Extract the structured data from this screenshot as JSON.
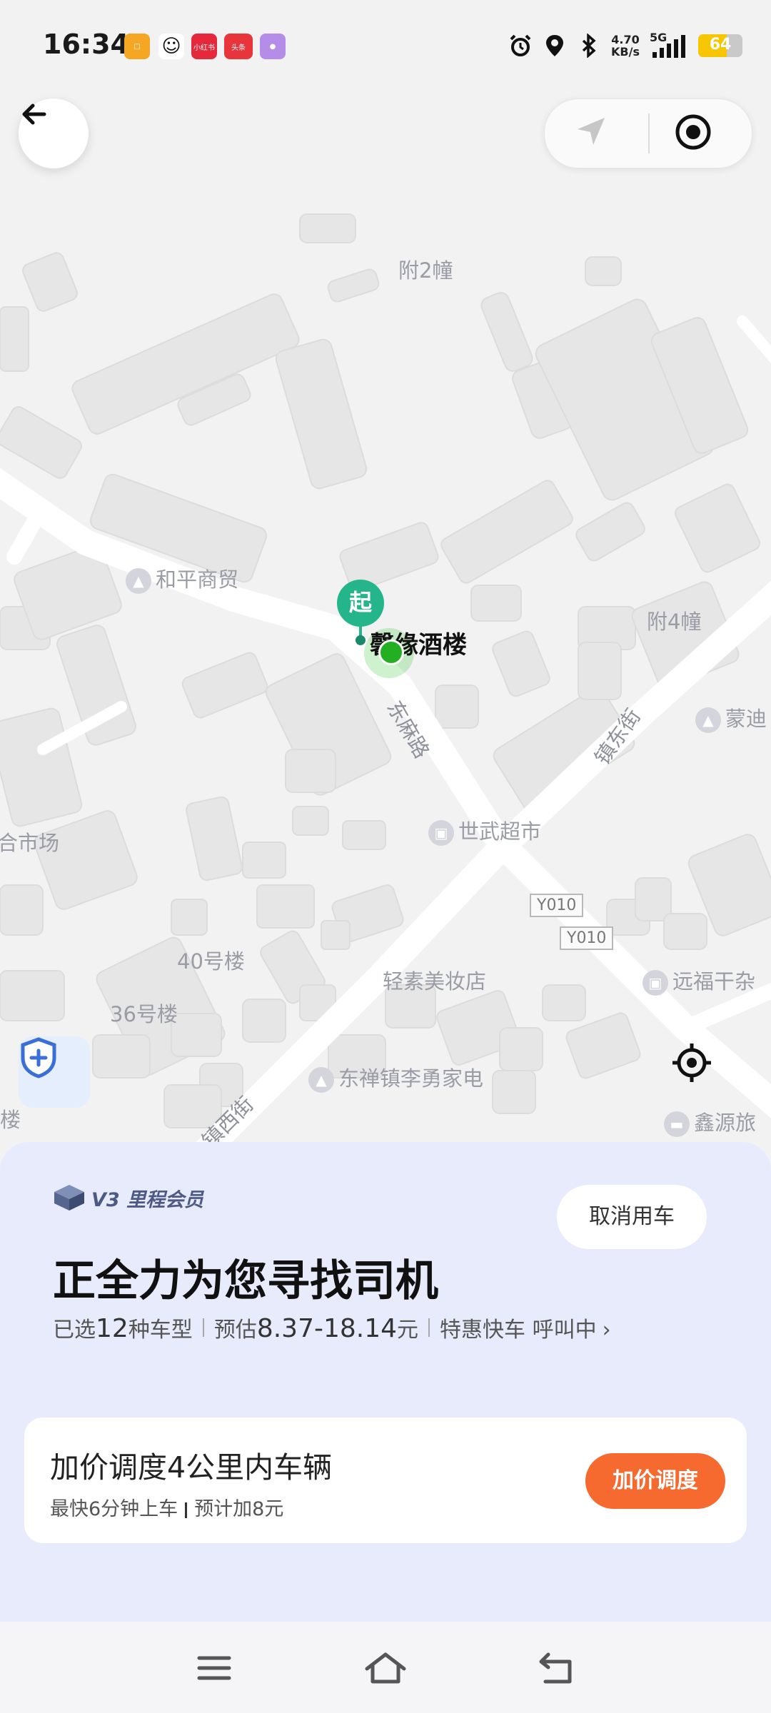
{
  "status_bar": {
    "time": "16:34",
    "notifications": [
      "小红书",
      "头条"
    ],
    "net_speed_value": "4.70",
    "net_speed_unit": "KB/s",
    "signal": "5G",
    "battery_percent": "64"
  },
  "map": {
    "labels": {
      "building_2": "附2幢",
      "building_4": "附4幢",
      "heping": "和平商贸",
      "place": "馨缘酒楼",
      "shiwu": "世武超市",
      "mengdi": "蒙迪",
      "market": "合市场",
      "b40": "40号楼",
      "b36": "36号楼",
      "qingsu": "轻素美妆店",
      "yuanfu": "远福干杂",
      "dongchan": "东禅镇李勇家电",
      "xinyuan": "鑫源旅",
      "lou": "楼"
    },
    "roads": {
      "dongma": "东麻路",
      "zhendong": "镇东街",
      "zhenxi": "镇西街",
      "y010_a": "Y010",
      "y010_b": "Y010"
    },
    "start_marker": "起"
  },
  "sheet": {
    "member_badge": "V3 里程会员",
    "cancel_label": "取消用车",
    "title": "正全力为您寻找司机",
    "selected_prefix": "已选",
    "selected_count": "12",
    "selected_suffix": "种车型",
    "estimate_prefix": "预估",
    "estimate_range": "8.37-18.14",
    "estimate_unit": "元",
    "service": "特惠快车 呼叫中",
    "boost": {
      "title": "加价调度4公里内车辆",
      "sub_left": "最快6分钟上车",
      "sub_right": "预计加8元",
      "button": "加价调度"
    }
  },
  "colors": {
    "accent_orange": "#f66a30",
    "marker_green": "#25b58b",
    "sheet_bg": "#e8ebfb",
    "battery": "#f7c600"
  }
}
